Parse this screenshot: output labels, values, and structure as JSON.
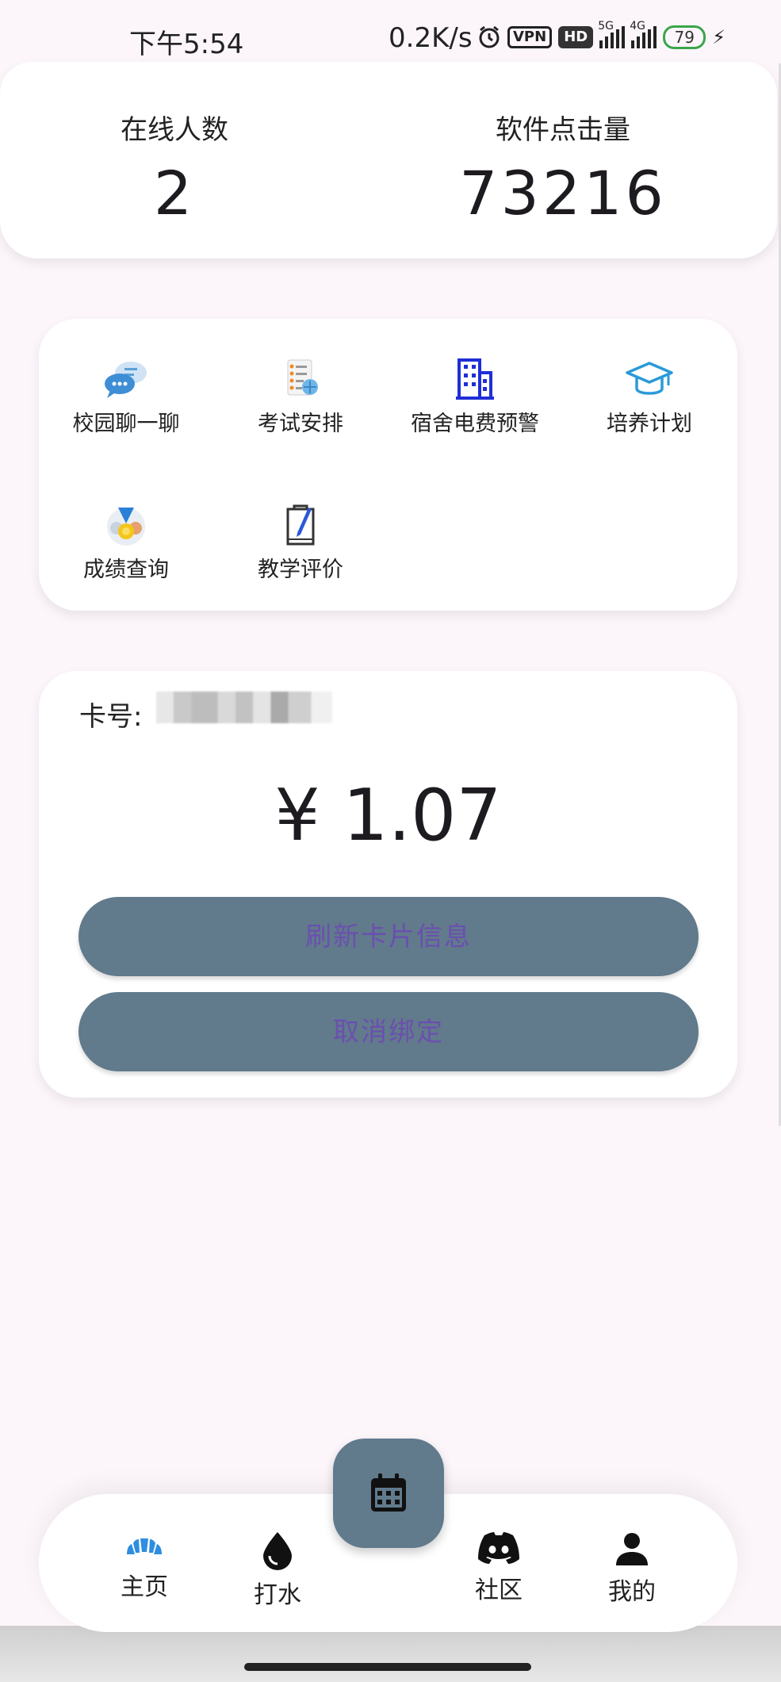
{
  "status_bar": {
    "time": "下午5:54",
    "network_speed": "0.2K/s",
    "vpn_label": "VPN",
    "hd_label": "HD",
    "signal_5g": "5G",
    "signal_4g": "4G",
    "battery": "79"
  },
  "stats": {
    "online_label": "在线人数",
    "online_value": "2",
    "clicks_label": "软件点击量",
    "clicks_value": "73216"
  },
  "functions": [
    {
      "label": "校园聊一聊",
      "icon": "chat-bubbles-icon"
    },
    {
      "label": "考试安排",
      "icon": "exam-list-icon"
    },
    {
      "label": "宿舍电费预警",
      "icon": "building-icon"
    },
    {
      "label": "培养计划",
      "icon": "graduation-cap-icon"
    },
    {
      "label": "成绩查询",
      "icon": "medal-icon"
    },
    {
      "label": "教学评价",
      "icon": "clipboard-pen-icon"
    }
  ],
  "card": {
    "number_label": "卡号:",
    "balance": "¥ 1.07",
    "refresh_label": "刷新卡片信息",
    "unbind_label": "取消绑定"
  },
  "nav": {
    "items": [
      {
        "label": "主页",
        "icon": "home-fan-icon",
        "active": true
      },
      {
        "label": "打水",
        "icon": "water-drop-icon",
        "active": false
      },
      {
        "label": "社区",
        "icon": "discord-icon",
        "active": false
      },
      {
        "label": "我的",
        "icon": "person-icon",
        "active": false
      }
    ],
    "fab_icon": "calendar-icon"
  },
  "colors": {
    "accent": "#617a8c",
    "button_text": "#6b4fb0",
    "background": "#fcf6fb",
    "active_icon": "#2e8de0"
  }
}
